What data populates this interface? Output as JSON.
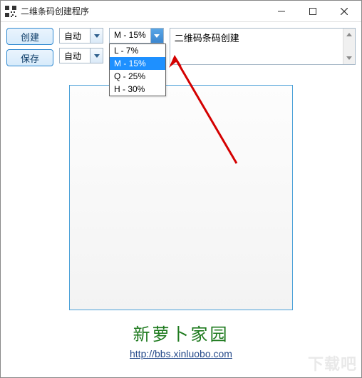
{
  "window": {
    "title": "二维条码创建程序"
  },
  "toolbar": {
    "create_label": "创建",
    "save_label": "保存",
    "sizeCombo1": {
      "value": "自动"
    },
    "sizeCombo2": {
      "value": "自动"
    },
    "eccCombo": {
      "value": "M - 15%",
      "options": [
        "L - 7%",
        "M - 15%",
        "Q - 25%",
        "H - 30%"
      ],
      "selectedIndex": 1
    }
  },
  "input": {
    "text": "二维码条码创建"
  },
  "footer": {
    "title": "新萝卜家园",
    "url": "http://bbs.xinluobo.com"
  },
  "watermark": "下载吧"
}
